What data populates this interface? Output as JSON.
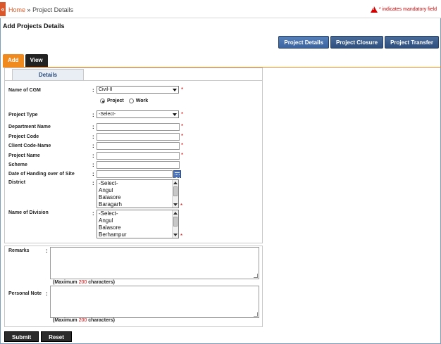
{
  "breadcrumb": {
    "home_glyph": "«",
    "home": "Home",
    "separator": "»",
    "current": "Project Details"
  },
  "mandatory_note": "* indicates mandatory field",
  "page_title": "Add Projects Details",
  "top_buttons": [
    "Project Details",
    "Project Closure",
    "Project Transfer"
  ],
  "tabs": {
    "add": "Add",
    "view": "View"
  },
  "details_tab": "Details",
  "form": {
    "cgm": {
      "label": "Name of CGM",
      "value": "Civil-II"
    },
    "radio": {
      "project": "Project",
      "work": "Work",
      "selected": "Project"
    },
    "project_type": {
      "label": "Project Type",
      "value": "-Select-"
    },
    "department_name": {
      "label": "Department Name"
    },
    "project_code": {
      "label": "Project Code"
    },
    "client_code_name": {
      "label": "Client Code-Name"
    },
    "project_name": {
      "label": "Project Name"
    },
    "scheme": {
      "label": "Scheme"
    },
    "handing_over_date": {
      "label": "Date of Handing over of Site"
    },
    "district": {
      "label": "District",
      "options": [
        "-Select-",
        "Angul",
        "Balasore",
        "Baragarh"
      ]
    },
    "division": {
      "label": "Name of Division",
      "options": [
        "-Select-",
        "Angul",
        "Balasore",
        "Berhampur"
      ]
    }
  },
  "remarks": {
    "label": "Remarks",
    "max_prefix": "(Maximum",
    "max_num": "200",
    "max_suffix": "characters)"
  },
  "personal_note": {
    "label": "Personal Note",
    "max_prefix": "(Maximum",
    "max_num": "200",
    "max_suffix": "characters)"
  },
  "colon": ":",
  "star": "*",
  "buttons": {
    "submit": "Submit",
    "reset": "Reset"
  },
  "colors": {
    "accent_orange": "#f0891e",
    "nav_blue": "#2c4f7f",
    "required_red": "#d40000"
  }
}
